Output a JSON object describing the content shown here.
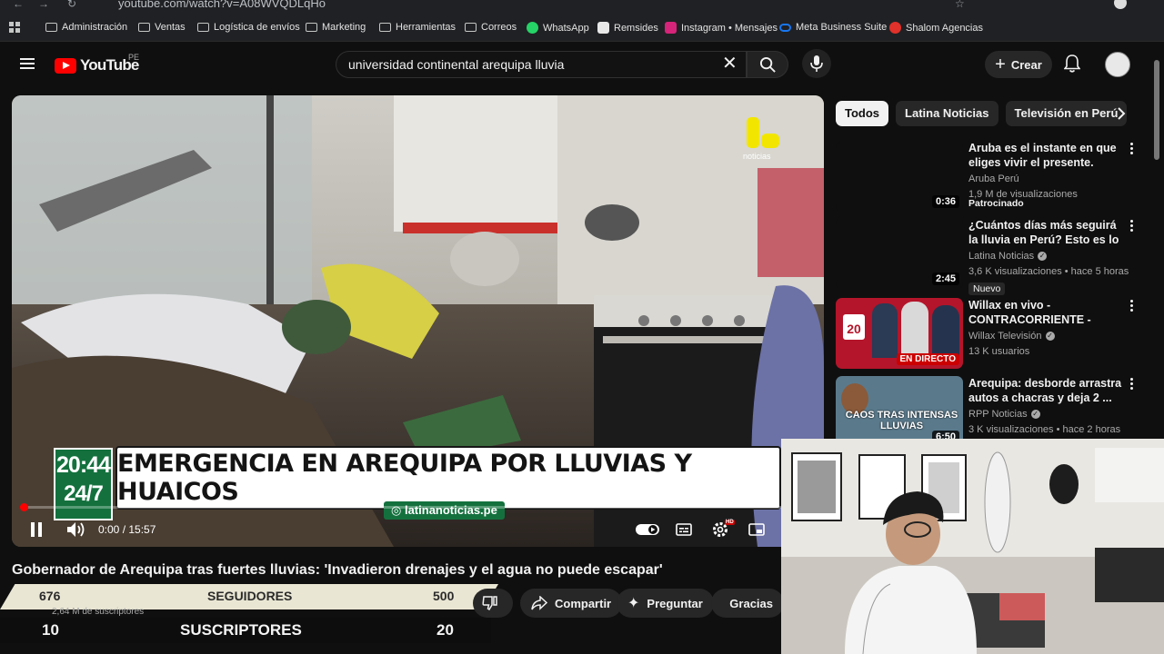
{
  "browser": {
    "url": "youtube.com/watch?v=A08WVQDLqHo",
    "bookmarks": [
      {
        "label": "Administración",
        "type": "folder"
      },
      {
        "label": "Ventas",
        "type": "folder"
      },
      {
        "label": "Logística de envíos",
        "type": "folder"
      },
      {
        "label": "Marketing",
        "type": "folder"
      },
      {
        "label": "Herramientas",
        "type": "folder"
      },
      {
        "label": "Correos",
        "type": "folder"
      },
      {
        "label": "WhatsApp",
        "type": "whatsapp-icon"
      },
      {
        "label": "Remsides",
        "type": "site-icon"
      },
      {
        "label": "Instagram • Mensajes",
        "type": "instagram-icon"
      },
      {
        "label": "Meta Business Suite",
        "type": "meta-icon"
      },
      {
        "label": "Shalom Agencias",
        "type": "shalom-icon"
      }
    ]
  },
  "header": {
    "logo_text": "YouTube",
    "country_code": "PE",
    "search_value": "universidad continental arequipa lluvia",
    "create_label": "Crear"
  },
  "player": {
    "time_display": "0:00 / 15:57",
    "progress_fraction": 0.0,
    "chyron_time": "20:44",
    "chyron_tag": "24/7",
    "chyron_headline": "EMERGENCIA EN AREQUIPA POR LLUVIAS Y HUAICOS",
    "chyron_handle": "latinanoticias.pe",
    "channel_bug": "noticias",
    "hd_badge": "HD"
  },
  "video": {
    "title": "Gobernador de Arequipa tras fuertes lluvias: 'Invadieron drenajes y el agua no puede escapar'",
    "subscribers": "2,64 M de suscriptores",
    "share_label": "Compartir",
    "ask_label": "Preguntar",
    "thanks_label": "Gracias"
  },
  "stream_overlay": {
    "followers_current": "676",
    "followers_label": "SEGUIDORES",
    "followers_goal": "500",
    "subs_current": "10",
    "subs_label": "SUSCRIPTORES",
    "subs_goal": "20"
  },
  "chips": [
    "Todos",
    "Latina Noticias",
    "Televisión en Perú"
  ],
  "recommendations": [
    {
      "title": "Aruba es el instante en que eliges vivir el presente. Aruba....",
      "channel": "Aruba Perú",
      "meta": "1,9 M de visualizaciones",
      "badge": "Patrocinado",
      "duration": "0:36",
      "verified": false
    },
    {
      "title": "¿Cuántos días más seguirá la lluvia en Perú? Esto es lo que ...",
      "channel": "Latina Noticias",
      "meta": "3,6 K visualizaciones • hace 5 horas",
      "badge": "Nuevo",
      "duration": "2:45",
      "verified": true
    },
    {
      "title": "Willax en vivo - CONTRACORRIENTE - BETO A...",
      "channel": "Willax Televisión",
      "meta": "13 K usuarios",
      "badge": "",
      "duration": "EN DIRECTO",
      "verified": true,
      "thumb_text": "20"
    },
    {
      "title": "Arequipa: desborde arrastra autos a chacras y deja 2 ...",
      "channel": "RPP Noticias",
      "meta": "3 K visualizaciones • hace 2 horas",
      "badge": "",
      "duration": "6:50",
      "verified": true,
      "thumb_text": "CAOS TRAS INTENSAS LLUVIAS"
    }
  ],
  "colors": {
    "yt_red": "#ff0000",
    "latina_green": "#14713e",
    "background": "#0f0f0f"
  }
}
